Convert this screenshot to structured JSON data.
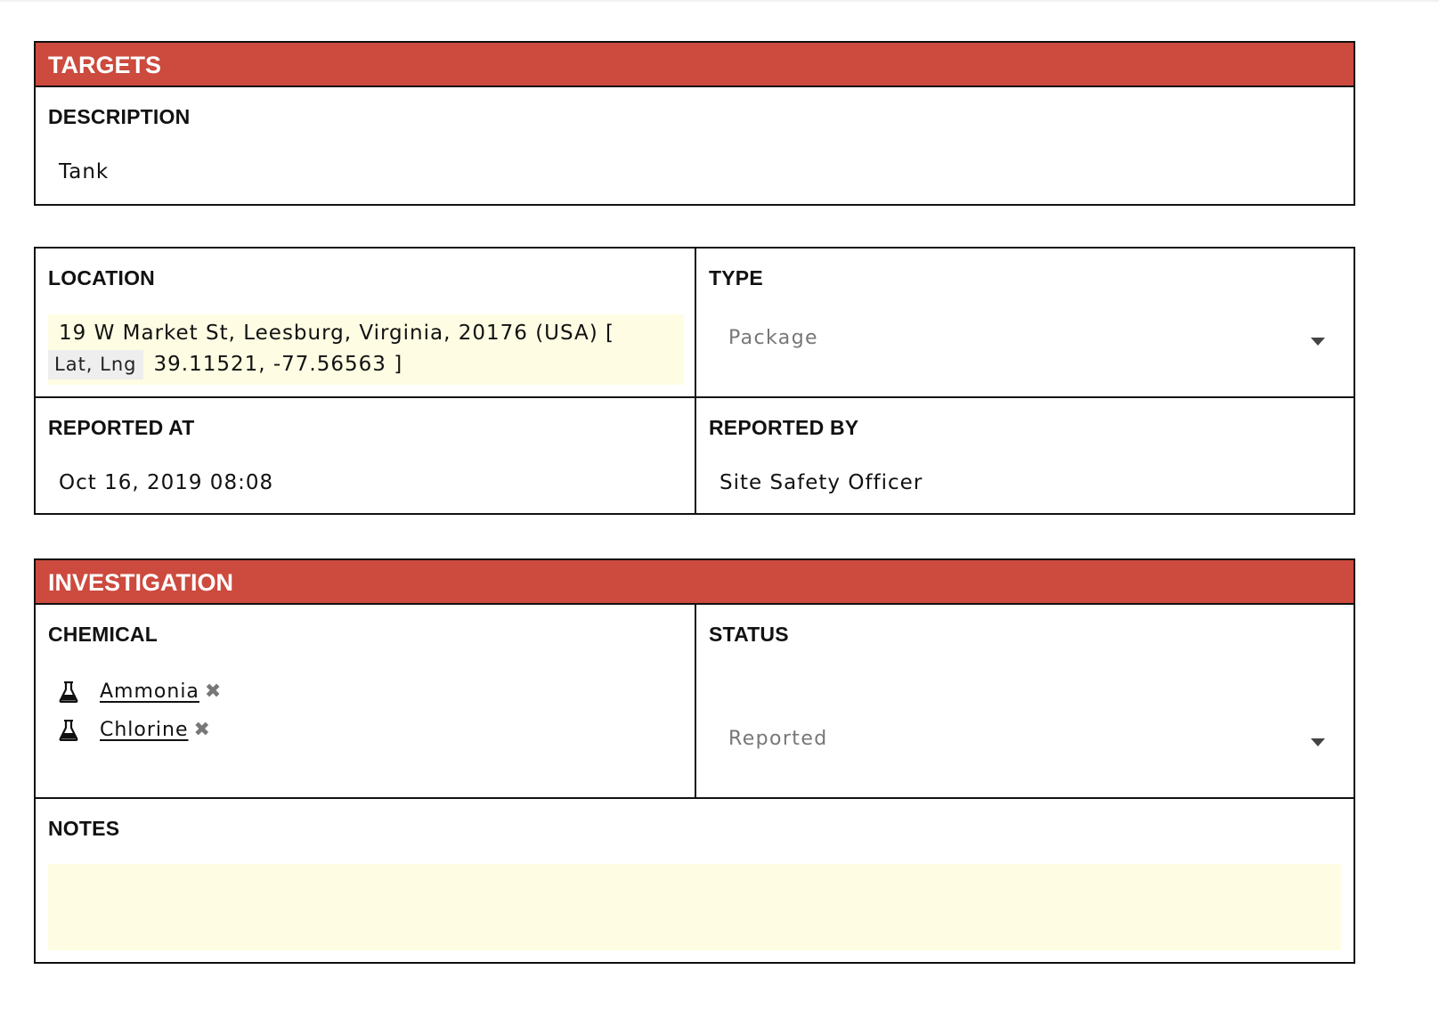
{
  "targets": {
    "title": "TARGETS",
    "description_label": "DESCRIPTION",
    "description_value": "Tank"
  },
  "location": {
    "label": "LOCATION",
    "address": "19 W Market St, Leesburg, Virginia, 20176 (USA) [",
    "latlng_tag": "Lat, Lng",
    "coords": "39.11521, -77.56563 ]"
  },
  "type": {
    "label": "TYPE",
    "value": "Package"
  },
  "reported_at": {
    "label": "REPORTED AT",
    "value": "Oct 16, 2019 08:08"
  },
  "reported_by": {
    "label": "REPORTED BY",
    "value": "Site Safety Officer"
  },
  "investigation": {
    "title": "INVESTIGATION",
    "chemical_label": "CHEMICAL",
    "chemicals": [
      {
        "name": "Ammonia",
        "icon": "flask-icon",
        "remove_icon": "remove-icon"
      },
      {
        "name": "Chlorine",
        "icon": "flask-icon",
        "remove_icon": "remove-icon"
      }
    ],
    "remove_glyph": "✖",
    "status_label": "STATUS",
    "status_value": "Reported",
    "notes_label": "NOTES",
    "notes_value": ""
  },
  "colors": {
    "header_red": "#cc4a3e",
    "highlight_yellow": "#fefde3",
    "border": "#111111"
  }
}
